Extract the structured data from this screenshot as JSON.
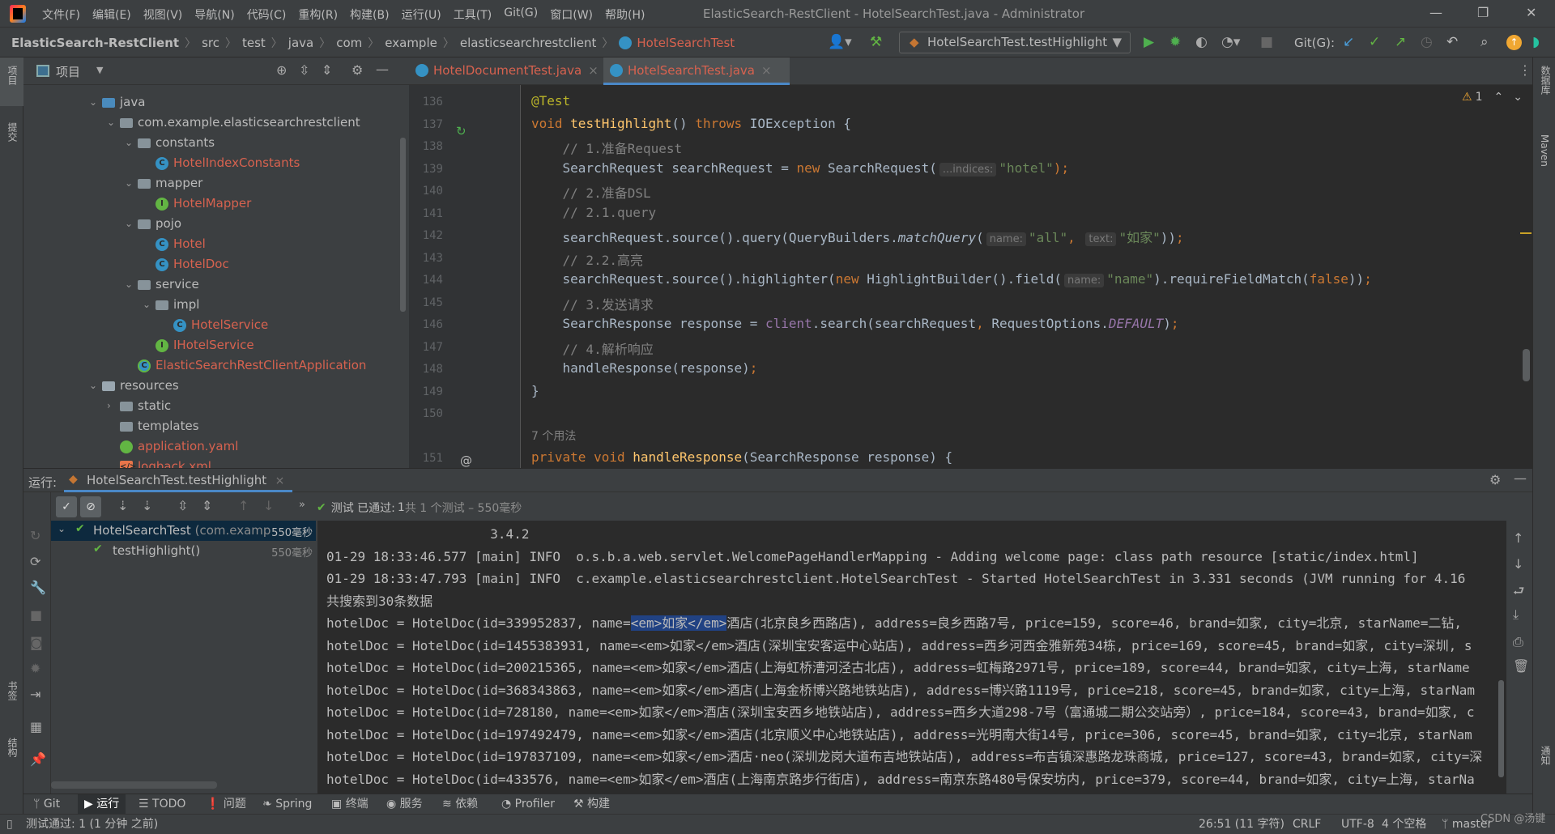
{
  "window": {
    "title": "ElasticSearch-RestClient - HotelSearchTest.java - Administrator",
    "menu": [
      "文件(F)",
      "编辑(E)",
      "视图(V)",
      "导航(N)",
      "代码(C)",
      "重构(R)",
      "构建(B)",
      "运行(U)",
      "工具(T)",
      "Git(G)",
      "窗口(W)",
      "帮助(H)"
    ]
  },
  "breadcrumb": [
    "ElasticSearch-RestClient",
    "src",
    "test",
    "java",
    "com",
    "example",
    "elasticsearchrestclient",
    "HotelSearchTest"
  ],
  "toolbar": {
    "run_config": "HotelSearchTest.testHighlight",
    "git_label": "Git(G):"
  },
  "left_strip": [
    "项目",
    "提交",
    "书签",
    "结构"
  ],
  "right_strip": [
    "数据库",
    "Maven",
    "通知"
  ],
  "project": {
    "title": "项目",
    "tree": [
      {
        "label": "java",
        "depth": 0,
        "icon": "folder-src",
        "chevron": "down"
      },
      {
        "label": "com.example.elasticsearchrestclient",
        "depth": 1,
        "icon": "package",
        "chevron": "down"
      },
      {
        "label": "constants",
        "depth": 2,
        "icon": "package",
        "chevron": "down"
      },
      {
        "label": "HotelIndexConstants",
        "depth": 3,
        "icon": "class",
        "chevron": ""
      },
      {
        "label": "mapper",
        "depth": 2,
        "icon": "package",
        "chevron": "down"
      },
      {
        "label": "HotelMapper",
        "depth": 3,
        "icon": "interface",
        "chevron": ""
      },
      {
        "label": "pojo",
        "depth": 2,
        "icon": "package",
        "chevron": "down"
      },
      {
        "label": "Hotel",
        "depth": 3,
        "icon": "class",
        "chevron": ""
      },
      {
        "label": "HotelDoc",
        "depth": 3,
        "icon": "class",
        "chevron": ""
      },
      {
        "label": "service",
        "depth": 2,
        "icon": "package",
        "chevron": "down"
      },
      {
        "label": "impl",
        "depth": 3,
        "icon": "package",
        "chevron": "down"
      },
      {
        "label": "HotelService",
        "depth": 4,
        "icon": "class",
        "chevron": ""
      },
      {
        "label": "IHotelService",
        "depth": 3,
        "icon": "interface",
        "chevron": ""
      },
      {
        "label": "ElasticSearchRestClientApplication",
        "depth": 2,
        "icon": "spring-app",
        "chevron": ""
      },
      {
        "label": "resources",
        "depth": 0,
        "icon": "folder-res",
        "chevron": "down"
      },
      {
        "label": "static",
        "depth": 1,
        "icon": "folder",
        "chevron": "right"
      },
      {
        "label": "templates",
        "depth": 1,
        "icon": "folder",
        "chevron": ""
      },
      {
        "label": "application.yaml",
        "depth": 1,
        "icon": "yaml",
        "chevron": ""
      },
      {
        "label": "logback.xml",
        "depth": 1,
        "icon": "xml",
        "chevron": ""
      }
    ]
  },
  "editor": {
    "tabs": [
      {
        "label": "HotelDocumentTest.java",
        "active": false
      },
      {
        "label": "HotelSearchTest.java",
        "active": true
      }
    ],
    "warnings": "1",
    "lines": [
      {
        "n": "136",
        "tokens": [
          [
            "ann",
            "@Test"
          ]
        ]
      },
      {
        "n": "137",
        "tokens": [
          [
            "kw",
            "void "
          ],
          [
            "fn",
            "testHighlight"
          ],
          [
            "",
            "() "
          ],
          [
            "kw",
            "throws "
          ],
          [
            "",
            "IOException {"
          ]
        ]
      },
      {
        "n": "138",
        "tokens": [
          [
            "com",
            "    // 1.准备Request"
          ]
        ]
      },
      {
        "n": "139",
        "tokens": [
          [
            "",
            "    SearchRequest searchRequest = "
          ],
          [
            "kw",
            "new "
          ],
          [
            "",
            "SearchRequest("
          ],
          [
            "hint",
            "...indices:"
          ],
          [
            "str",
            "\"hotel\""
          ],
          [
            "kw",
            ");"
          ]
        ]
      },
      {
        "n": "140",
        "tokens": [
          [
            "com",
            "    // 2.准备DSL"
          ]
        ]
      },
      {
        "n": "141",
        "tokens": [
          [
            "com",
            "    // 2.1.query"
          ]
        ]
      },
      {
        "n": "142",
        "tokens": [
          [
            "",
            "    searchRequest.source().query(QueryBuilders."
          ],
          [
            "static",
            "matchQuery"
          ],
          [
            "",
            "("
          ],
          [
            "hint",
            "name:"
          ],
          [
            "str",
            "\"all\""
          ],
          [
            "kw",
            ", "
          ],
          [
            "hint",
            "text:"
          ],
          [
            "str",
            "\"如家\""
          ],
          [
            "",
            "))"
          ],
          [
            "kw",
            ";"
          ]
        ]
      },
      {
        "n": "143",
        "tokens": [
          [
            "com",
            "    // 2.2.高亮"
          ]
        ]
      },
      {
        "n": "144",
        "tokens": [
          [
            "",
            "    searchRequest.source().highlighter("
          ],
          [
            "kw",
            "new "
          ],
          [
            "",
            "HighlightBuilder().field("
          ],
          [
            "hint",
            "name:"
          ],
          [
            "str",
            "\"name\""
          ],
          [
            "",
            ").requireFieldMatch("
          ],
          [
            "kw",
            "false"
          ],
          [
            "",
            "))"
          ],
          [
            "kw",
            ";"
          ]
        ]
      },
      {
        "n": "145",
        "tokens": [
          [
            "com",
            "    // 3.发送请求"
          ]
        ]
      },
      {
        "n": "146",
        "tokens": [
          [
            "",
            "    SearchResponse response = "
          ],
          [
            "fld",
            "client"
          ],
          [
            "",
            ".search(searchRequest"
          ],
          [
            "kw",
            ", "
          ],
          [
            "",
            "RequestOptions."
          ],
          [
            "ital",
            "DEFAULT"
          ],
          [
            "",
            ")"
          ],
          [
            "kw",
            ";"
          ]
        ]
      },
      {
        "n": "147",
        "tokens": [
          [
            "com",
            "    // 4.解析响应"
          ]
        ]
      },
      {
        "n": "148",
        "tokens": [
          [
            "",
            "    handleResponse(response)"
          ],
          [
            "kw",
            ";"
          ]
        ]
      },
      {
        "n": "149",
        "tokens": [
          [
            "",
            "}"
          ]
        ]
      },
      {
        "n": "150",
        "tokens": []
      },
      {
        "n": "",
        "tokens": [
          [
            "usage",
            "7 个用法"
          ]
        ]
      },
      {
        "n": "151",
        "tokens": [
          [
            "kw",
            "private void "
          ],
          [
            "fn",
            "handleResponse"
          ],
          [
            "",
            "(SearchResponse response) {"
          ]
        ]
      }
    ]
  },
  "run": {
    "label": "运行:",
    "tab": "HotelSearchTest.testHighlight",
    "status_prefix": "测试 已通过:",
    "status_count": "1",
    "status_suffix": "共 1 个测试 – 550毫秒",
    "tree": [
      {
        "label": "HotelSearchTest",
        "sub": "(com.examp",
        "time": "550毫秒"
      },
      {
        "label": "testHighlight()",
        "sub": "",
        "time": "550毫秒"
      }
    ],
    "console": [
      [
        "                     3.4.2"
      ],
      [
        "01-29 18:33:46.577 [main] INFO  o.s.b.a.web.servlet.WelcomePageHandlerMapping - Adding welcome page: class path resource [static/index.html]"
      ],
      [
        "01-29 18:33:47.793 [main] INFO  c.example.elasticsearchrestclient.HotelSearchTest - Started HotelSearchTest in 3.331 seconds (JVM running for 4.16"
      ],
      [
        "共搜索到30条数据"
      ],
      [
        "hotelDoc = HotelDoc(id=339952837, name=",
        "<em>如家</em>",
        "酒店(北京良乡西路店), address=良乡西路7号, price=159, score=46, brand=如家, city=北京, starName=二钻, "
      ],
      [
        "hotelDoc = HotelDoc(id=1455383931, name=<em>如家</em>酒店(深圳宝安客运中心站店), address=西乡河西金雅新苑34栋, price=169, score=45, brand=如家, city=深圳, s"
      ],
      [
        "hotelDoc = HotelDoc(id=200215365, name=<em>如家</em>酒店(上海虹桥漕河泾古北店), address=虹梅路2971号, price=189, score=44, brand=如家, city=上海, starName"
      ],
      [
        "hotelDoc = HotelDoc(id=368343863, name=<em>如家</em>酒店(上海金桥博兴路地铁站店), address=博兴路1119号, price=218, score=45, brand=如家, city=上海, starNam"
      ],
      [
        "hotelDoc = HotelDoc(id=728180, name=<em>如家</em>酒店(深圳宝安西乡地铁站店), address=西乡大道298-7号（富通城二期公交站旁）, price=184, score=43, brand=如家, c"
      ],
      [
        "hotelDoc = HotelDoc(id=197492479, name=<em>如家</em>酒店(北京顺义中心地铁站店), address=光明南大街14号, price=306, score=45, brand=如家, city=北京, starNam"
      ],
      [
        "hotelDoc = HotelDoc(id=197837109, name=<em>如家</em>酒店·neo(深圳龙岗大道布吉地铁站店), address=布吉镇深惠路龙珠商城, price=127, score=43, brand=如家, city=深"
      ],
      [
        "hotelDoc = HotelDoc(id=433576, name=<em>如家</em>酒店(上海南京路步行街店), address=南京东路480号保安坊内, price=379, score=44, brand=如家, city=上海, starNa"
      ]
    ]
  },
  "bottom_tabs": [
    "Git",
    "运行",
    "TODO",
    "问题",
    "Spring",
    "终端",
    "服务",
    "依赖",
    "Profiler",
    "构建"
  ],
  "status": {
    "message": "测试通过: 1 (1 分钟 之前)",
    "position": "26:51 (11 字符)",
    "line_sep": "CRLF",
    "encoding": "UTF-8",
    "indent": "4 个空格",
    "branch": "master",
    "watermark": "CSDN @汤键"
  },
  "colors": {
    "accent": "#4a88c7",
    "pass": "#62b543",
    "untracked": "#d7624f",
    "selection": "#214283"
  }
}
